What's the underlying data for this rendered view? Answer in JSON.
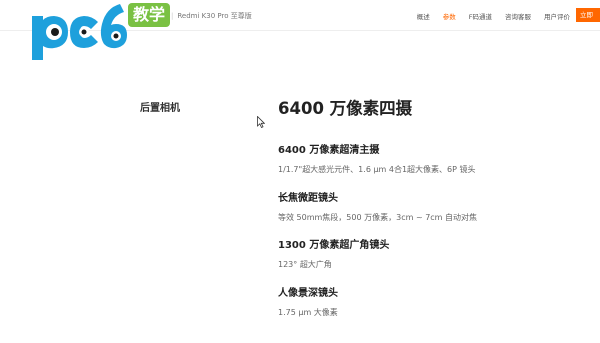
{
  "header": {
    "product_fragment": "ro",
    "product_name": "Redmi K30 Pro 至尊版",
    "nav": [
      {
        "label": "概述",
        "active": false
      },
      {
        "label": "参数",
        "active": true
      },
      {
        "label": "F码通道",
        "active": false
      },
      {
        "label": "咨询客服",
        "active": false
      },
      {
        "label": "用户评价",
        "active": false
      }
    ],
    "buy_label": "立即",
    "accent_color": "#ff6700"
  },
  "watermark": {
    "logo_text": "pc6",
    "badge_text": "教学",
    "icon": "pc6-logo-icon"
  },
  "section": {
    "label": "后置相机",
    "title": "6400 万像素四摄",
    "specs": [
      {
        "heading": "6400 万像素超清主摄",
        "detail": "1/1.7\"超大感光元件、1.6 μm 4合1超大像素、6P 镜头"
      },
      {
        "heading": "长焦微距镜头",
        "detail": "等效 50mm焦段，500 万像素，3cm ~ 7cm 自动对焦"
      },
      {
        "heading": "1300 万像素超广角镜头",
        "detail": "123° 超大广角"
      },
      {
        "heading": "人像景深镜头",
        "detail": "1.75 μm 大像素"
      }
    ]
  }
}
